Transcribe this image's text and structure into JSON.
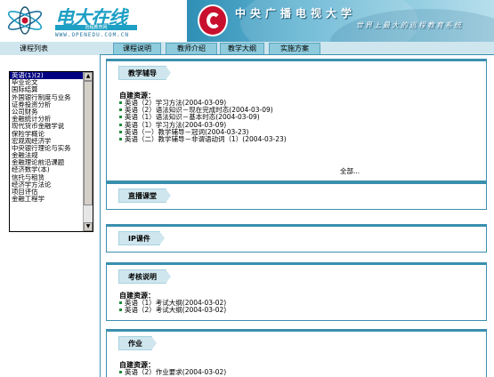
{
  "header": {
    "logo_title": "电大在线",
    "logo_subtitle": "远程教育网",
    "logo_url": "WWW.OPENEDU.COM.CN",
    "banner_title": "中央广播电视大学",
    "banner_slogan": "世界上最大的远程教育系统"
  },
  "sidebar": {
    "title": "课程列表",
    "items": [
      "英语(1)(2)",
      "毕业论文",
      "国际结算",
      "外国银行制度与业务",
      "证券投资分析",
      "公司财务",
      "金融统计分析",
      "现代货币金融学说",
      "保险学概论",
      "宏观观经济学",
      "中央银行理论与实务",
      "金融法规",
      "金融理论前沿课题",
      "经济数学(本)",
      "信托与租赁",
      "经济学方法论",
      "项目评估",
      "金融工程学"
    ],
    "selected_index": 0
  },
  "tabs": [
    "课程说明",
    "教师介绍",
    "教学大纲",
    "实施方案"
  ],
  "panels": {
    "tutoring": {
      "title": "教学辅导",
      "label": "自建资源：",
      "items": [
        "英语（2）学习方法(2004-03-09)",
        "英语（2）语法知识－现在完成时态(2004-03-09)",
        "英语（1）语法知识－基本时态(2004-03-09)",
        "英语（1）学习方法(2004-03-09)",
        "英语（一）教学辅导－冠词(2004-03-23)",
        "英语（二）教学辅导－非谓语动词（1）(2004-03-23)"
      ],
      "more": "全部..."
    },
    "live": {
      "title": "直播课堂"
    },
    "ip": {
      "title": "IP课件"
    },
    "exam": {
      "title": "考核说明",
      "label": "自建资源：",
      "items": [
        "英语（1）考试大纲(2004-03-02)",
        "英语（2）考试大纲(2004-03-02)"
      ]
    },
    "homework": {
      "title": "作业",
      "label": "自建资源：",
      "items": [
        "英语（2）作业要求(2004-03-02)"
      ]
    }
  },
  "colors": {
    "accent": "#3a8fae",
    "tab_fill": "#8ecbdc",
    "header_fill": "#cfe6ee",
    "selected": "#000080",
    "bullet": "#1e8b3a"
  }
}
